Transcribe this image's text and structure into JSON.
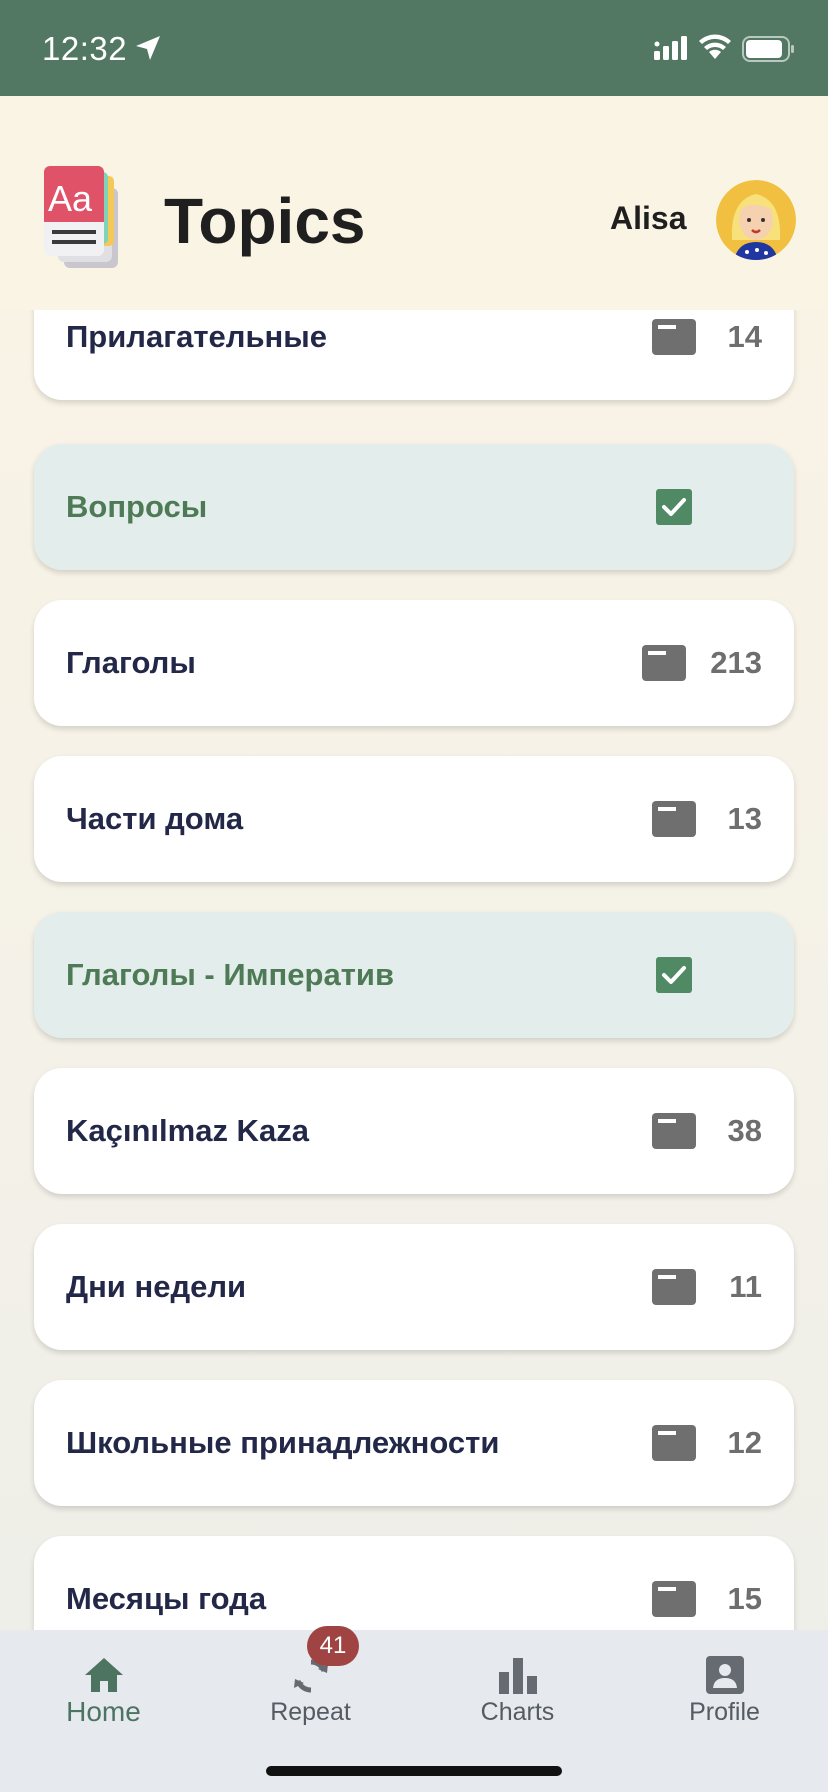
{
  "status_bar": {
    "time": "12:32"
  },
  "header": {
    "title": "Topics",
    "user_name": "Alisa"
  },
  "topics": [
    {
      "name": "Прилагательные",
      "count": "14",
      "done": false
    },
    {
      "name": "Вопросы",
      "count": "",
      "done": true
    },
    {
      "name": "Глаголы",
      "count": "213",
      "done": false
    },
    {
      "name": "Части дома",
      "count": "13",
      "done": false
    },
    {
      "name": "Глаголы - Императив",
      "count": "",
      "done": true
    },
    {
      "name": "Kaçınılmaz Kaza",
      "count": "38",
      "done": false
    },
    {
      "name": "Дни недели",
      "count": "11",
      "done": false
    },
    {
      "name": "Школьные принадлежности",
      "count": "12",
      "done": false
    },
    {
      "name": "Месяцы года",
      "count": "15",
      "done": false
    }
  ],
  "tab_bar": {
    "tabs": [
      {
        "label": "Home",
        "icon": "home-icon",
        "active": true
      },
      {
        "label": "Repeat",
        "icon": "repeat-icon",
        "active": false,
        "badge": "41"
      },
      {
        "label": "Charts",
        "icon": "bar-chart-icon",
        "active": false
      },
      {
        "label": "Profile",
        "icon": "profile-icon",
        "active": false
      }
    ]
  },
  "colors": {
    "status_bar": "#527763",
    "accent_green": "#4f7a56",
    "badge_red": "#a04343",
    "topic_text": "#232848"
  }
}
